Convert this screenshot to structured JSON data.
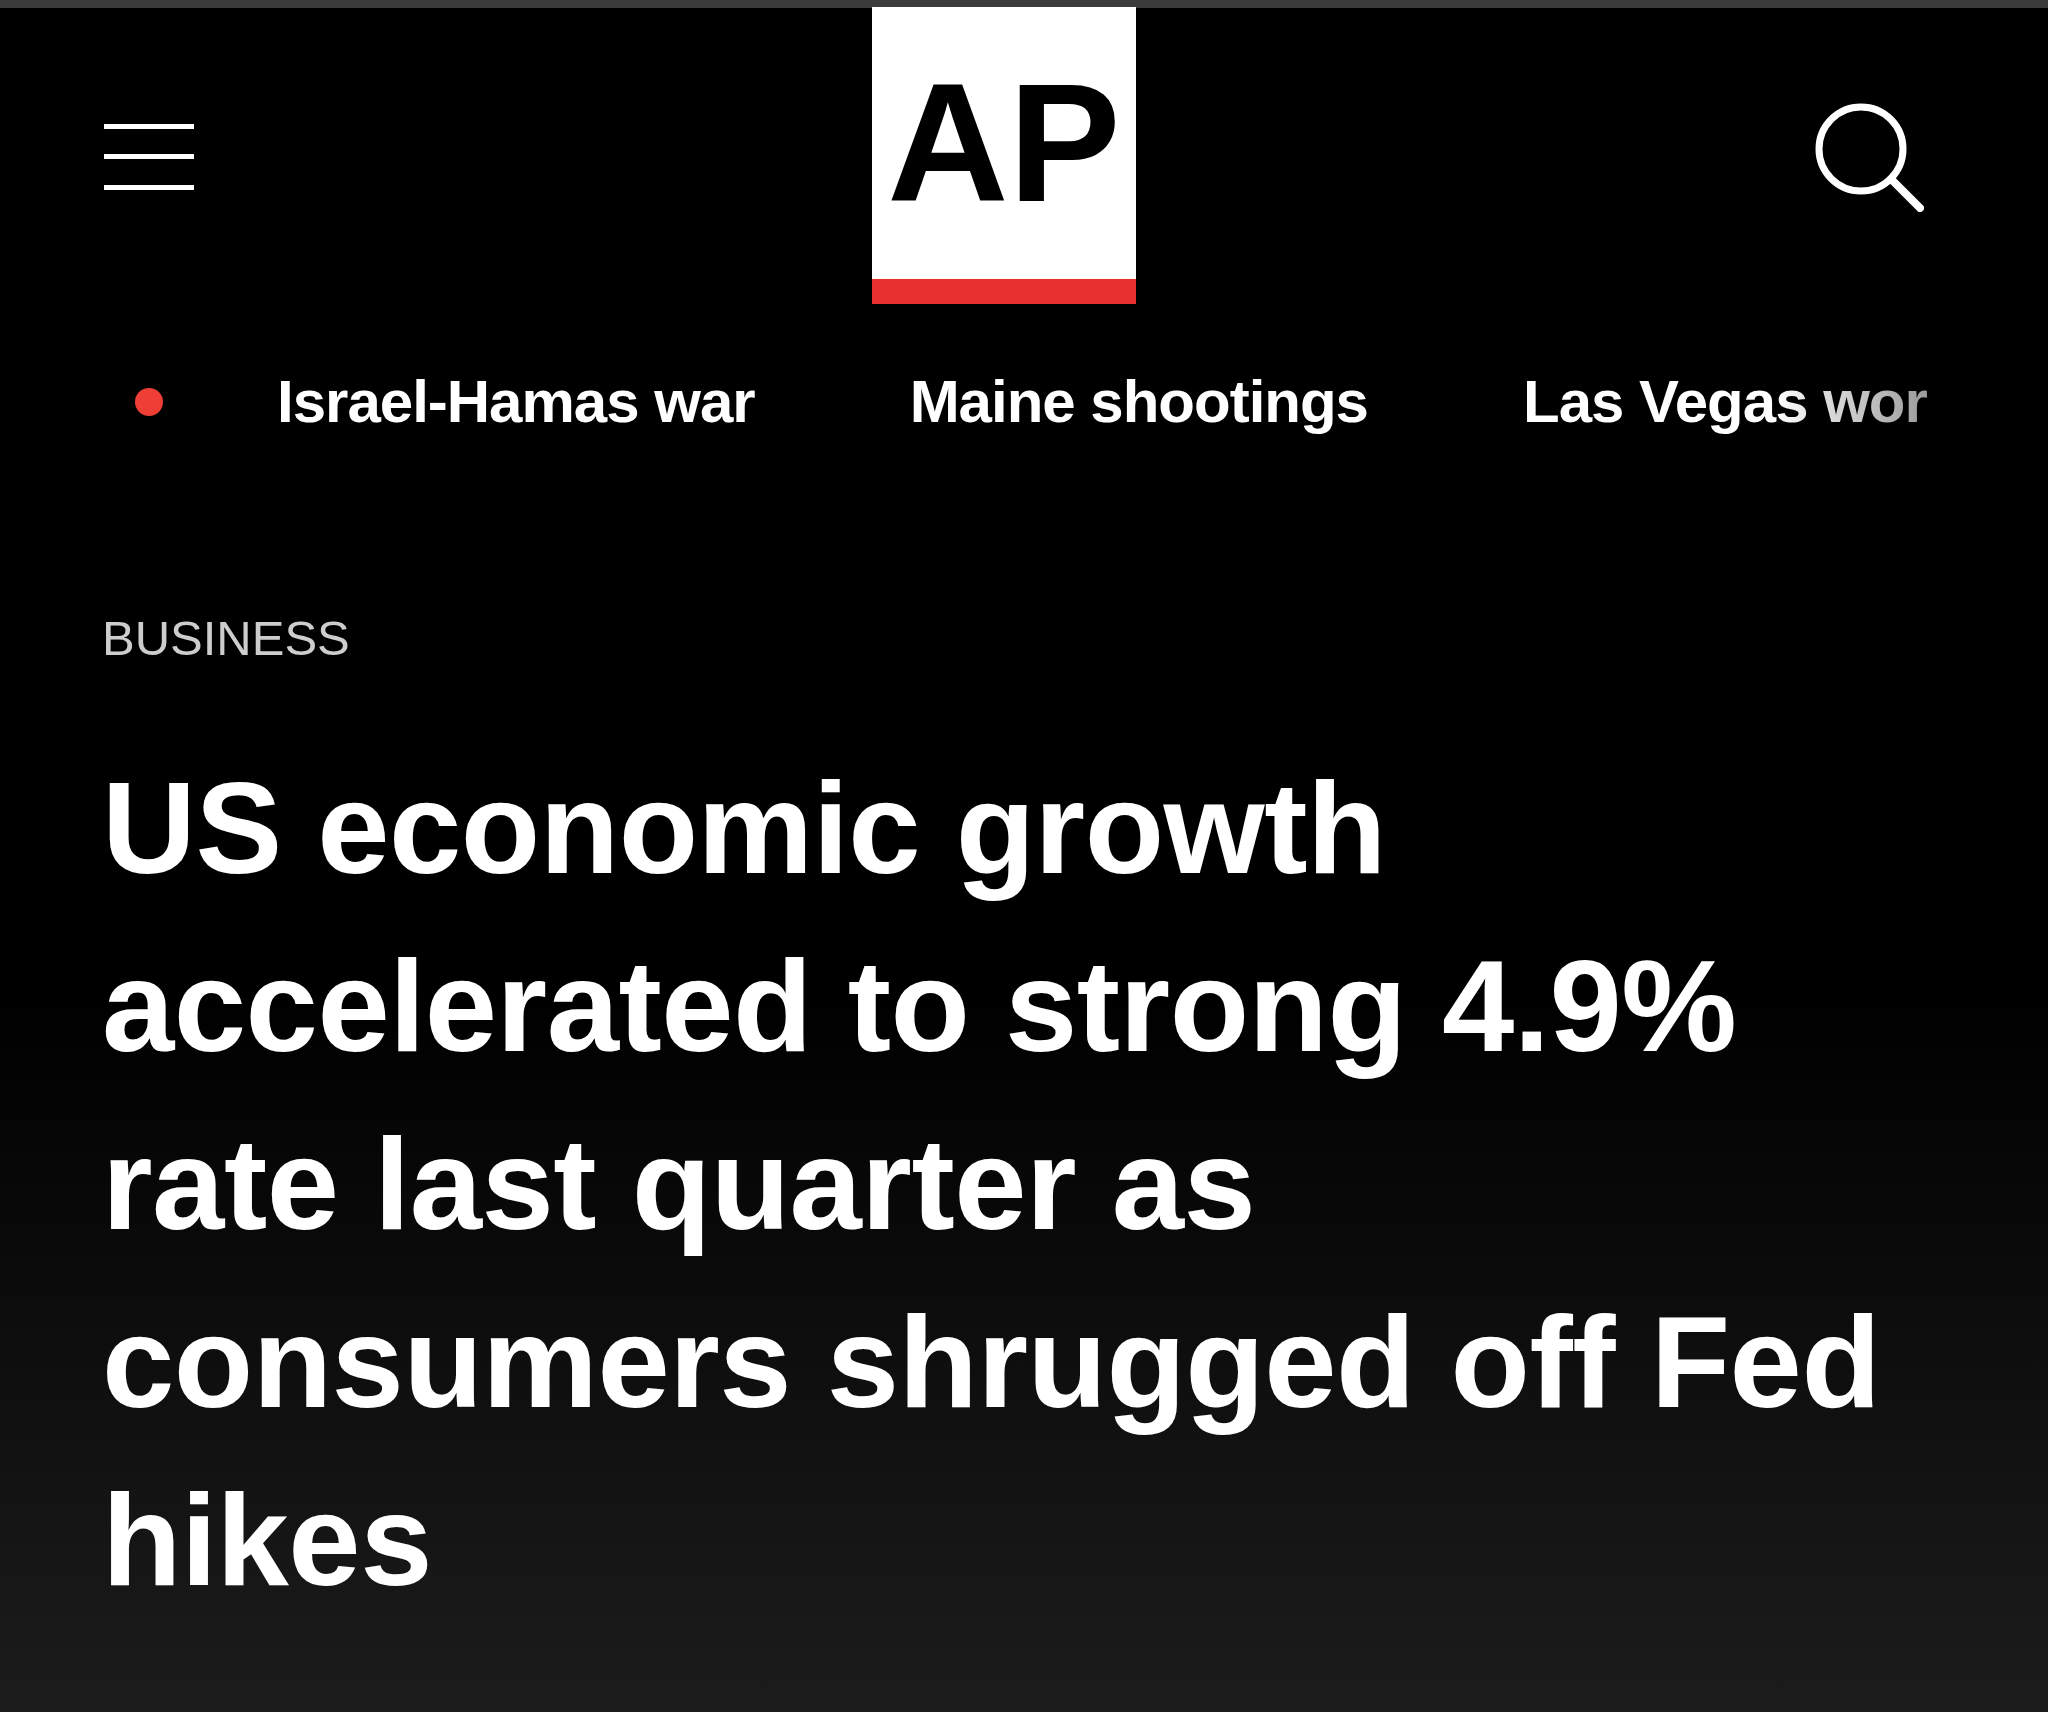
{
  "header": {
    "logo": {
      "text": "AP"
    }
  },
  "trending": {
    "items": [
      {
        "label": "Israel-Hamas war"
      },
      {
        "label": "Maine shootings"
      },
      {
        "label": "Las Vegas wor"
      }
    ]
  },
  "article": {
    "category": "BUSINESS",
    "headline": "US economic growth accelerated to strong 4.9% rate last quarter as consumers shrugged off Fed hikes"
  }
}
